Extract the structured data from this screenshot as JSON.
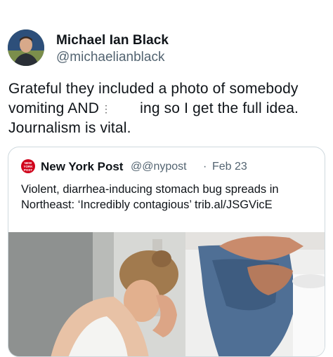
{
  "tweet": {
    "author_name": "Michael Ian Black",
    "author_handle": "@michaelianblack",
    "text_line1": "Grateful they included a photo of somebody",
    "text_line2_a": "vomiting AND",
    "text_line2_b": "ing so I get the full idea.",
    "text_line3": "Journalism is vital.",
    "hidden_mark": "⋮"
  },
  "quote": {
    "logo_text": [
      "NEW",
      "YORK",
      "POST"
    ],
    "source_name": "New York Post",
    "source_handle": "@@nypost",
    "separator": "·",
    "date": "Feb 23",
    "text": "Violent, diarrhea-inducing stomach bug spreads in Northeast: ‘Incredibly contagious’ trib.al/JSGVicE"
  },
  "colors": {
    "brand_red": "#d0021b",
    "secondary_text": "#536471",
    "border": "#cfd9de"
  }
}
